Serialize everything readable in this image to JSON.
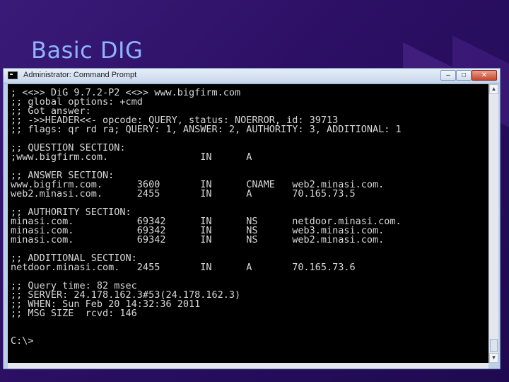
{
  "slide": {
    "title": "Basic DIG"
  },
  "window": {
    "title": "Administrator: Command Prompt",
    "controls": {
      "minimize": "–",
      "maximize": "□",
      "close": "✕"
    },
    "icon": "console-icon"
  },
  "console": {
    "lines": [
      "; <<>> DiG 9.7.2-P2 <<>> www.bigfirm.com",
      ";; global options: +cmd",
      ";; Got answer:",
      ";; ->>HEADER<<- opcode: QUERY, status: NOERROR, id: 39713",
      ";; flags: qr rd ra; QUERY: 1, ANSWER: 2, AUTHORITY: 3, ADDITIONAL: 1",
      "",
      ";; QUESTION SECTION:",
      ";www.bigfirm.com.                IN      A",
      "",
      ";; ANSWER SECTION:",
      "www.bigfirm.com.      3600       IN      CNAME   web2.minasi.com.",
      "web2.minasi.com.      2455       IN      A       70.165.73.5",
      "",
      ";; AUTHORITY SECTION:",
      "minasi.com.           69342      IN      NS      netdoor.minasi.com.",
      "minasi.com.           69342      IN      NS      web3.minasi.com.",
      "minasi.com.           69342      IN      NS      web2.minasi.com.",
      "",
      ";; ADDITIONAL SECTION:",
      "netdoor.minasi.com.   2455       IN      A       70.165.73.6",
      "",
      ";; Query time: 82 msec",
      ";; SERVER: 24.178.162.3#53(24.178.162.3)",
      ";; WHEN: Sun Feb 20 14:32:36 2011",
      ";; MSG SIZE  rcvd: 146",
      "",
      "",
      "C:\\>"
    ]
  },
  "colors": {
    "slide_title": "#8fb4ff",
    "console_bg": "#000000",
    "console_text": "#d8d8d8"
  }
}
